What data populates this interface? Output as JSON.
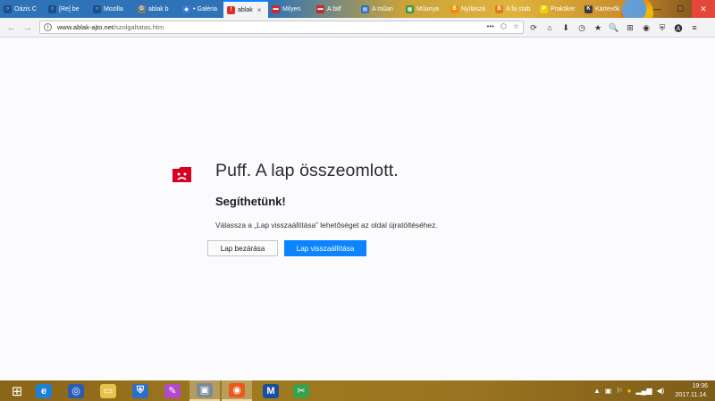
{
  "browser": {
    "tabs": [
      {
        "label": "Oázis C",
        "fav_color": "#1b4e8c",
        "fav_glyph": "○",
        "active": false
      },
      {
        "label": "[Re] be",
        "fav_color": "#1b4e8c",
        "fav_glyph": "○",
        "active": false
      },
      {
        "label": "Mozilla",
        "fav_color": "#1b4e8c",
        "fav_glyph": "○",
        "active": false
      },
      {
        "label": "ablak b",
        "fav_color": "#7a7a7a",
        "fav_glyph": "G",
        "active": false
      },
      {
        "label": "• Galéria",
        "fav_color": "#3b7bd6",
        "fav_glyph": "◆",
        "active": false
      },
      {
        "label": "ablak",
        "fav_color": "#d93025",
        "fav_glyph": "!",
        "active": true
      },
      {
        "label": "Milyen",
        "fav_color": "#cc2a2a",
        "fav_glyph": "▬",
        "active": false
      },
      {
        "label": "A falf",
        "fav_color": "#cc2a2a",
        "fav_glyph": "▬",
        "active": false
      },
      {
        "label": "A műan",
        "fav_color": "#2a6fc9",
        "fav_glyph": "▤",
        "active": false
      },
      {
        "label": "Műanya",
        "fav_color": "#3a9a3a",
        "fav_glyph": "▦",
        "active": false
      },
      {
        "label": "Nyílászá",
        "fav_color": "#f08a00",
        "fav_glyph": "B",
        "active": false
      },
      {
        "label": "A fa stab",
        "fav_color": "#e87a10",
        "fav_glyph": "B",
        "active": false
      },
      {
        "label": "Praktiker",
        "fav_color": "#f2d000",
        "fav_glyph": "P",
        "active": false
      },
      {
        "label": "Kártevők",
        "fav_color": "#3a3a3a",
        "fav_glyph": "K",
        "active": false
      }
    ],
    "window_controls": {
      "minimize": "—",
      "maximize": "☐",
      "close": "✕"
    },
    "back_icon": "←",
    "forward_icon": "→",
    "url_host": "www.ablak-ajto.net",
    "url_path": "/szolgaltatas.htm",
    "url_actions": [
      "•••",
      "⬡",
      "☆"
    ],
    "toolbar_icons": [
      "⟳",
      "⌂",
      "⬇",
      "◷",
      "★",
      "🔍",
      "⊞",
      "◉",
      "⛨",
      "🅐",
      "≡"
    ]
  },
  "crash": {
    "title": "Puff. A lap összeomlott.",
    "subtitle": "Segíthetünk!",
    "description": "Válassza a „Lap visszaállítása” lehetőséget az oldal újratöltéséhez.",
    "close_button": "Lap bezárása",
    "restore_button": "Lap visszaállítása",
    "icon_color": "#d70022"
  },
  "taskbar": {
    "apps": [
      {
        "name": "start-button",
        "glyph": "⊞",
        "bg": "transparent",
        "active": false
      },
      {
        "name": "internet-explorer",
        "glyph": "e",
        "bg": "#1e7fd6",
        "active": false
      },
      {
        "name": "outlook",
        "glyph": "◎",
        "bg": "#2a5bb5",
        "active": false
      },
      {
        "name": "file-explorer",
        "glyph": "▭",
        "bg": "#e8c24a",
        "active": false
      },
      {
        "name": "security",
        "glyph": "⛨",
        "bg": "#2a6fc9",
        "active": false
      },
      {
        "name": "paint",
        "glyph": "✎",
        "bg": "#b24ac9",
        "active": false
      },
      {
        "name": "network-app",
        "glyph": "▣",
        "bg": "#7a8a9a",
        "active": true
      },
      {
        "name": "firefox",
        "glyph": "◉",
        "bg": "#e8591a",
        "active": true
      },
      {
        "name": "malwarebytes",
        "glyph": "M",
        "bg": "#1a4fa0",
        "active": false
      },
      {
        "name": "greenshot",
        "glyph": "✂",
        "bg": "#3aa04a",
        "active": false
      }
    ],
    "tray_icons": [
      "▲",
      "▣",
      "⚐",
      "●",
      "▂▄▆",
      "◀)"
    ],
    "time": "19:36",
    "date": "2017.11.14."
  }
}
